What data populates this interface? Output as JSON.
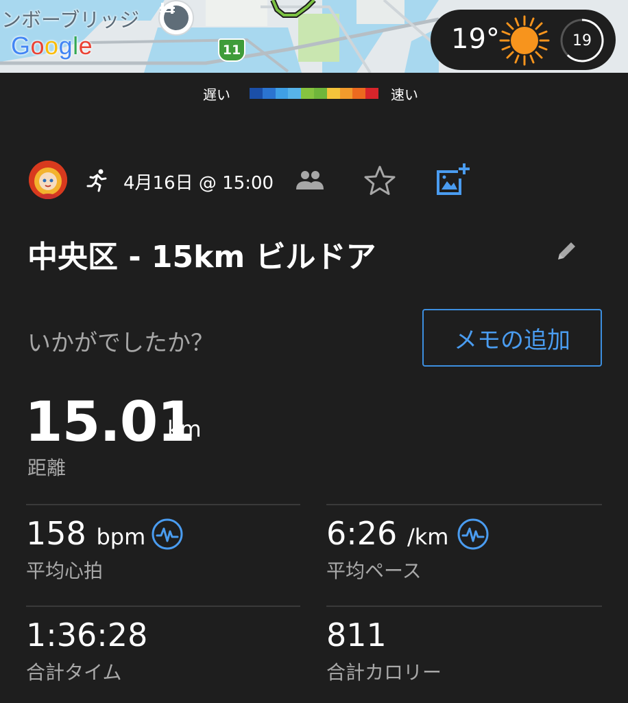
{
  "map": {
    "place_label": "ンボーブリッジ",
    "logo": "Google",
    "route_number": "11",
    "poi_icon": "bridge-icon"
  },
  "weather": {
    "temperature": "19°",
    "condition_icon": "sun-icon",
    "gauge_value": "19"
  },
  "legend": {
    "slow_label": "遅い",
    "fast_label": "速い",
    "colors": [
      "#1b4fa8",
      "#2b74d0",
      "#3fa0e6",
      "#57b4ea",
      "#86c440",
      "#6fb63b",
      "#f4c43b",
      "#f29b2c",
      "#ec6a1f",
      "#d8252b"
    ]
  },
  "activity": {
    "avatar": "user-avatar",
    "type_icon": "running-icon",
    "date": "4月16日 @ 15:00",
    "title": "中央区 - 15km ビルドア",
    "prompt": "いかがでしたか？",
    "memo_button": "メモの追加"
  },
  "stats": {
    "distance": {
      "value": "15.01",
      "unit": "km",
      "label": "距離"
    },
    "avg_hr": {
      "value": "158",
      "unit": "bpm",
      "label": "平均心拍"
    },
    "avg_pace": {
      "value": "6:26",
      "unit": "/km",
      "label": "平均ペース"
    },
    "total_time": {
      "value": "1:36:28",
      "label": "合計タイム"
    },
    "calories": {
      "value": "811",
      "label": "合計カロリー"
    }
  },
  "colors": {
    "background": "#1e1e1e",
    "accent": "#3d8fe0",
    "secondary_text": "#a9a9a9"
  }
}
